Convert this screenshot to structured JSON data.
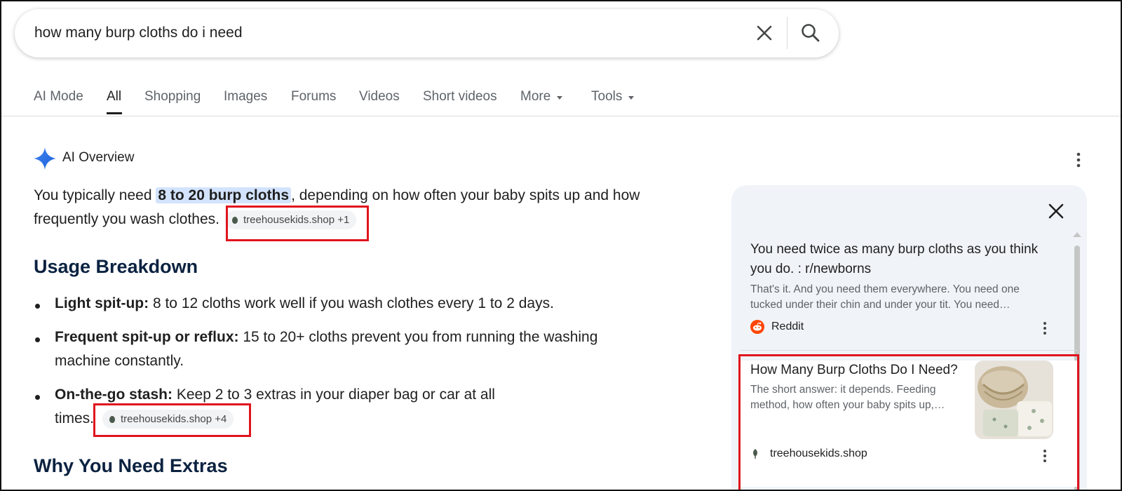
{
  "search": {
    "query": "how many burp cloths do i need"
  },
  "tabs": [
    {
      "label": "AI Mode"
    },
    {
      "label": "All"
    },
    {
      "label": "Shopping"
    },
    {
      "label": "Images"
    },
    {
      "label": "Forums"
    },
    {
      "label": "Videos"
    },
    {
      "label": "Short videos"
    },
    {
      "label": "More"
    },
    {
      "label": "Tools"
    }
  ],
  "overview": {
    "title": "AI Overview",
    "intro_before": "You typically need ",
    "intro_highlight": "8 to 20 burp cloths",
    "intro_after": ", depending on how often your baby spits up and how",
    "intro_line2": "frequently you wash clothes.",
    "intro_chip": "treehousekids.shop +1",
    "section1_heading": "Usage Breakdown",
    "bullets": [
      {
        "bold": "Light spit-up:",
        "text": " 8 to 12 cloths work well if you wash clothes every 1 to 2 days."
      },
      {
        "bold": "Frequent spit-up or reflux:",
        "text": " 15 to 20+ cloths prevent you from running the washing",
        "text2": "machine constantly."
      },
      {
        "bold": "On-the-go stash:",
        "text": " Keep 2 to 3 extras in your diaper bag or car at all",
        "text2": "times.",
        "chip": "treehousekids.shop +4"
      }
    ],
    "section2_heading": "Why You Need Extras"
  },
  "sources": [
    {
      "title_line1": "You need twice as many burp cloths as you think",
      "title_line2": "you do. : r/newborns",
      "snippet_line1": "That's it. And you need them everywhere. You need one",
      "snippet_line2": "tucked under their chin and under your tit. You need…",
      "site": "Reddit",
      "icon": "reddit-icon"
    },
    {
      "title_line1": "How Many Burp Cloths Do I Need?",
      "snippet_line1": "The short answer: it depends. Feeding",
      "snippet_line2": "method, how often your baby spits up,…",
      "site": "treehousekids.shop",
      "icon": "treehouse-leaf-icon"
    }
  ],
  "colors": {
    "highlight": "#d3e3fd",
    "heading": "#0b2240",
    "annotation_box": "#e0141e",
    "panel_bg": "#f0f4f9",
    "reddit": "#ff4500"
  }
}
